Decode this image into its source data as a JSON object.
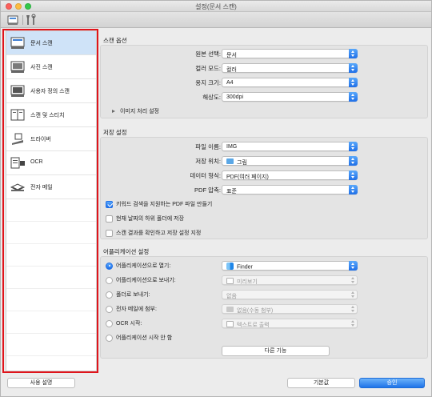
{
  "window": {
    "title": "설정(문서 스캔)"
  },
  "toolbar": {
    "icons": [
      "scan-settings-icon",
      "tools-icon"
    ]
  },
  "sidebar": {
    "items": [
      {
        "label": "문서 스캔",
        "icon": "document-scan-icon",
        "selected": true
      },
      {
        "label": "사진 스캔",
        "icon": "photo-scan-icon",
        "selected": false
      },
      {
        "label": "사용자 정의 스캔",
        "icon": "custom-scan-icon",
        "selected": false
      },
      {
        "label": "스캔 및 스티치",
        "icon": "scan-stitch-icon",
        "selected": false
      },
      {
        "label": "드라이버",
        "icon": "driver-icon",
        "selected": false
      },
      {
        "label": "OCR",
        "icon": "ocr-icon",
        "selected": false
      },
      {
        "label": "전자 메일",
        "icon": "email-icon",
        "selected": false
      }
    ]
  },
  "scan_options": {
    "title": "스캔 옵션",
    "source_label": "원본 선택:",
    "source_value": "문서",
    "color_mode_label": "컬러 모드:",
    "color_mode_value": "컬러",
    "paper_size_label": "용지 크기:",
    "paper_size_value": "A4",
    "resolution_label": "해상도:",
    "resolution_value": "300dpi",
    "image_processing_label": "이미지 처리 설정"
  },
  "save_settings": {
    "title": "저장 설정",
    "file_name_label": "파일 이름:",
    "file_name_value": "IMG",
    "save_in_label": "저장 위치:",
    "save_in_value": "그림",
    "data_format_label": "데이터 형식:",
    "data_format_value": "PDF(여러 페이지)",
    "pdf_compression_label": "PDF 압축:",
    "pdf_compression_value": "표준",
    "keyword_pdf_label": "키워드 검색을 지원하는 PDF 파일 만들기",
    "keyword_pdf_checked": true,
    "subfolder_label": "현재 날짜의 하위 폴더에 저장",
    "subfolder_checked": false,
    "check_results_label": "스캔 결과를 확인하고 저장 설정 지정",
    "check_results_checked": false
  },
  "app_settings": {
    "title": "어플리케이션 설정",
    "open_with_label": "어플리케이션으로 열기:",
    "open_with_value": "Finder",
    "send_to_app_label": "어플리케이션으로 보내기:",
    "send_to_app_value": "미리보기",
    "send_to_folder_label": "폴더로 보내기:",
    "send_to_folder_value": "없음",
    "attach_email_label": "전자 메일에 첨부:",
    "attach_email_value": "없음(수동 첨부)",
    "start_ocr_label": "OCR 시작:",
    "start_ocr_value": "텍스트로 출력",
    "no_app_label": "어플리케이션 시작 안 함",
    "more_functions_label": "다른 기능"
  },
  "footer": {
    "instructions_label": "사용 설명",
    "defaults_label": "기본값",
    "ok_label": "승인"
  },
  "colors": {
    "accent": "#1f6fe7",
    "highlight_frame": "#e0141b",
    "selected_row": "#cfe3f8"
  }
}
